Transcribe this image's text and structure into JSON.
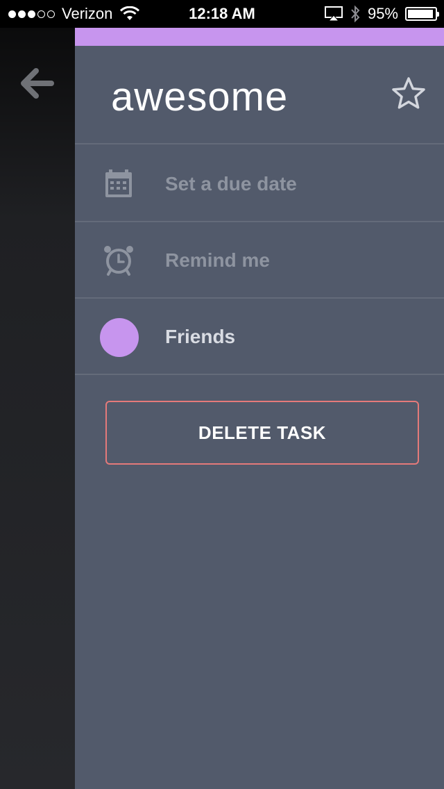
{
  "status_bar": {
    "carrier": "Verizon",
    "time": "12:18 AM",
    "battery_percent": "95%",
    "battery_level": 0.95,
    "signal_bars_on": 3,
    "signal_bars_total": 5
  },
  "navigation": {
    "back_icon": "arrow-left-icon"
  },
  "task": {
    "title": "awesome",
    "star_icon": "star-outline-icon",
    "accent_color": "#c795ee"
  },
  "details": {
    "due_date": {
      "icon": "calendar-icon",
      "label": "Set a due date"
    },
    "reminder": {
      "icon": "alarm-clock-icon",
      "label": "Remind me"
    },
    "list": {
      "label": "Friends",
      "color": "#c795ee"
    }
  },
  "actions": {
    "delete_label": "DELETE TASK",
    "delete_border_color": "#e57a7a"
  },
  "colors": {
    "panel_background": "#525a6b",
    "divider": "#646b7a",
    "muted_text": "#8e94a0"
  }
}
